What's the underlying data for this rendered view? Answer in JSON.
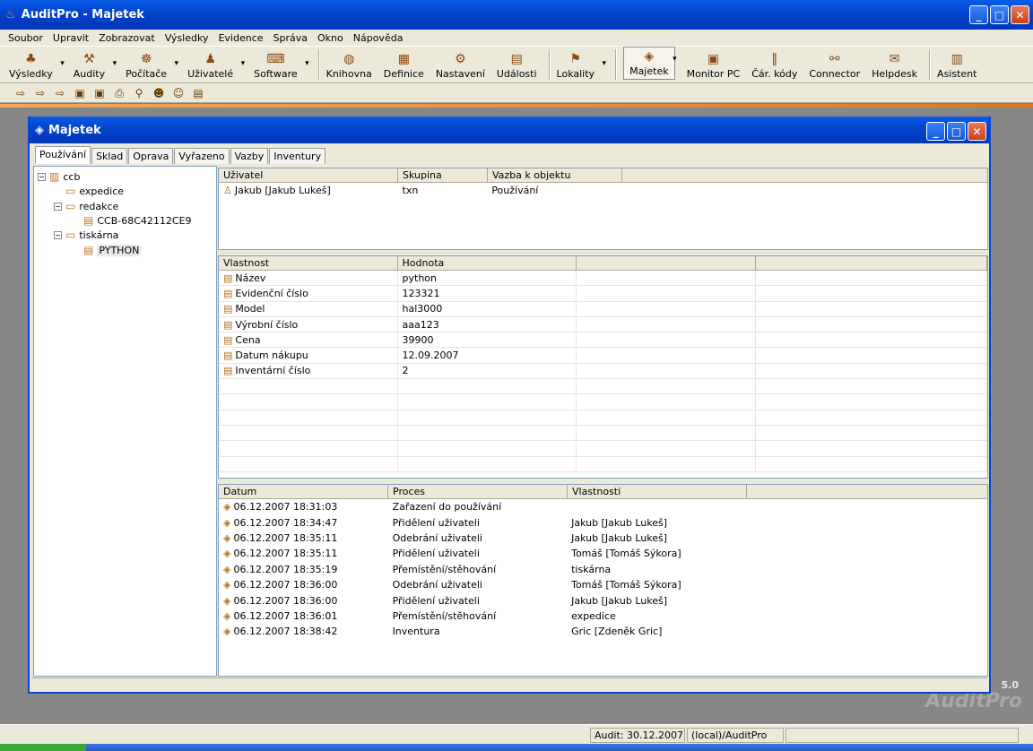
{
  "app": {
    "title": "AuditPro - Majetek"
  },
  "menu": [
    "Soubor",
    "Upravit",
    "Zobrazovat",
    "Výsledky",
    "Evidence",
    "Správa",
    "Okno",
    "Nápověda"
  ],
  "toolbar": [
    {
      "label": "Výsledky",
      "icon": "results-icon",
      "drop": true
    },
    {
      "label": "Audity",
      "icon": "audits-icon",
      "drop": true
    },
    {
      "label": "Počítače",
      "icon": "computers-icon",
      "drop": true
    },
    {
      "label": "Uživatelé",
      "icon": "users-icon",
      "drop": true
    },
    {
      "label": "Software",
      "icon": "software-icon",
      "drop": true
    },
    {
      "label": "Knihovna",
      "icon": "library-icon",
      "drop": false
    },
    {
      "label": "Definice",
      "icon": "definitions-icon",
      "drop": false
    },
    {
      "label": "Nastavení",
      "icon": "settings-icon",
      "drop": false
    },
    {
      "label": "Události",
      "icon": "events-icon",
      "drop": false
    },
    {
      "label": "Lokality",
      "icon": "locations-icon",
      "drop": true
    },
    {
      "label": "Majetek",
      "icon": "assets-icon",
      "drop": true,
      "selected": true
    },
    {
      "label": "Monitor PC",
      "icon": "monitor-icon",
      "drop": false
    },
    {
      "label": "Čár. kódy",
      "icon": "barcode-icon",
      "drop": false
    },
    {
      "label": "Connector",
      "icon": "connector-icon",
      "drop": false
    },
    {
      "label": "Helpdesk",
      "icon": "helpdesk-icon",
      "drop": false
    },
    {
      "label": "Asistent",
      "icon": "assistant-icon",
      "drop": false
    }
  ],
  "child": {
    "title": "Majetek",
    "tabs": [
      "Používání",
      "Sklad",
      "Oprava",
      "Vyřazeno",
      "Vazby",
      "Inventury"
    ],
    "tree": [
      {
        "label": "ccb",
        "level": 0
      },
      {
        "label": "expedice",
        "level": 1
      },
      {
        "label": "redakce",
        "level": 1
      },
      {
        "label": "CCB-68C42112CE9",
        "level": 2
      },
      {
        "label": "tiskárna",
        "level": 1
      },
      {
        "label": "PYTHON",
        "level": 2
      }
    ],
    "users": {
      "columns": [
        "Uživatel",
        "Skupina",
        "Vazba k objektu"
      ],
      "rows": [
        [
          "Jakub [Jakub Lukeš]",
          "txn",
          "Používání"
        ]
      ]
    },
    "props": {
      "columns": [
        "Vlastnost",
        "Hodnota",
        "",
        ""
      ],
      "rows": [
        [
          "Název",
          "python"
        ],
        [
          "Evidenční číslo",
          "123321"
        ],
        [
          "Model",
          "hal3000"
        ],
        [
          "Výrobní číslo",
          "aaa123"
        ],
        [
          "Cena",
          "39900"
        ],
        [
          "Datum nákupu",
          "12.09.2007"
        ],
        [
          "Inventární číslo",
          "2"
        ]
      ]
    },
    "history": {
      "columns": [
        "Datum",
        "Proces",
        "Vlastnosti"
      ],
      "rows": [
        [
          "06.12.2007 18:31:03",
          "Zařazení do používání",
          ""
        ],
        [
          "06.12.2007 18:34:47",
          "Přidělení uživateli",
          "Jakub [Jakub Lukeš]"
        ],
        [
          "06.12.2007 18:35:11",
          "Odebrání uživateli",
          "Jakub [Jakub Lukeš]"
        ],
        [
          "06.12.2007 18:35:11",
          "Přidělení uživateli",
          "Tomáš [Tomáš Sýkora]"
        ],
        [
          "06.12.2007 18:35:19",
          "Přemístění/stěhování",
          "tiskárna"
        ],
        [
          "06.12.2007 18:36:00",
          "Odebrání uživateli",
          "Tomáš [Tomáš Sýkora]"
        ],
        [
          "06.12.2007 18:36:00",
          "Přidělení uživateli",
          "Jakub [Jakub Lukeš]"
        ],
        [
          "06.12.2007 18:36:01",
          "Přemístění/stěhování",
          "expedice"
        ],
        [
          "06.12.2007 18:38:42",
          "Inventura",
          "Gric [Zdeněk Gric]"
        ]
      ]
    }
  },
  "status": {
    "audit": "Audit: 30.12.2007",
    "db": "(local)/AuditPro"
  },
  "branding": {
    "version": "5.0",
    "logo": "AuditPro"
  }
}
